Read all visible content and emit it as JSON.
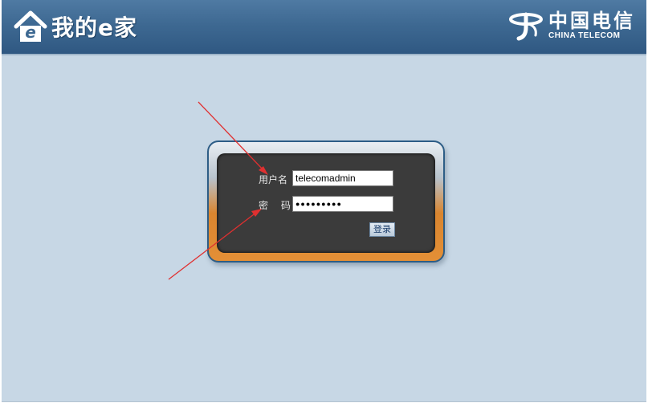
{
  "header": {
    "title": "我的e家",
    "brand_cn": "中国电信",
    "brand_en": "CHINA TELECOM"
  },
  "login": {
    "username_label": "用户名",
    "username_value": "telecomadmin",
    "password_label": "密 码",
    "password_masked": "●●●●●●●●●",
    "submit_label": "登录"
  },
  "colors": {
    "header_bg": "#3e6992",
    "page_bg": "#c7d7e5",
    "panel_frame": "#e38f36",
    "panel_inner": "#3b3b3b",
    "arrow": "#e03030"
  },
  "icons": {
    "app_logo": "house-e-icon",
    "brand_logo": "china-telecom-logo"
  }
}
